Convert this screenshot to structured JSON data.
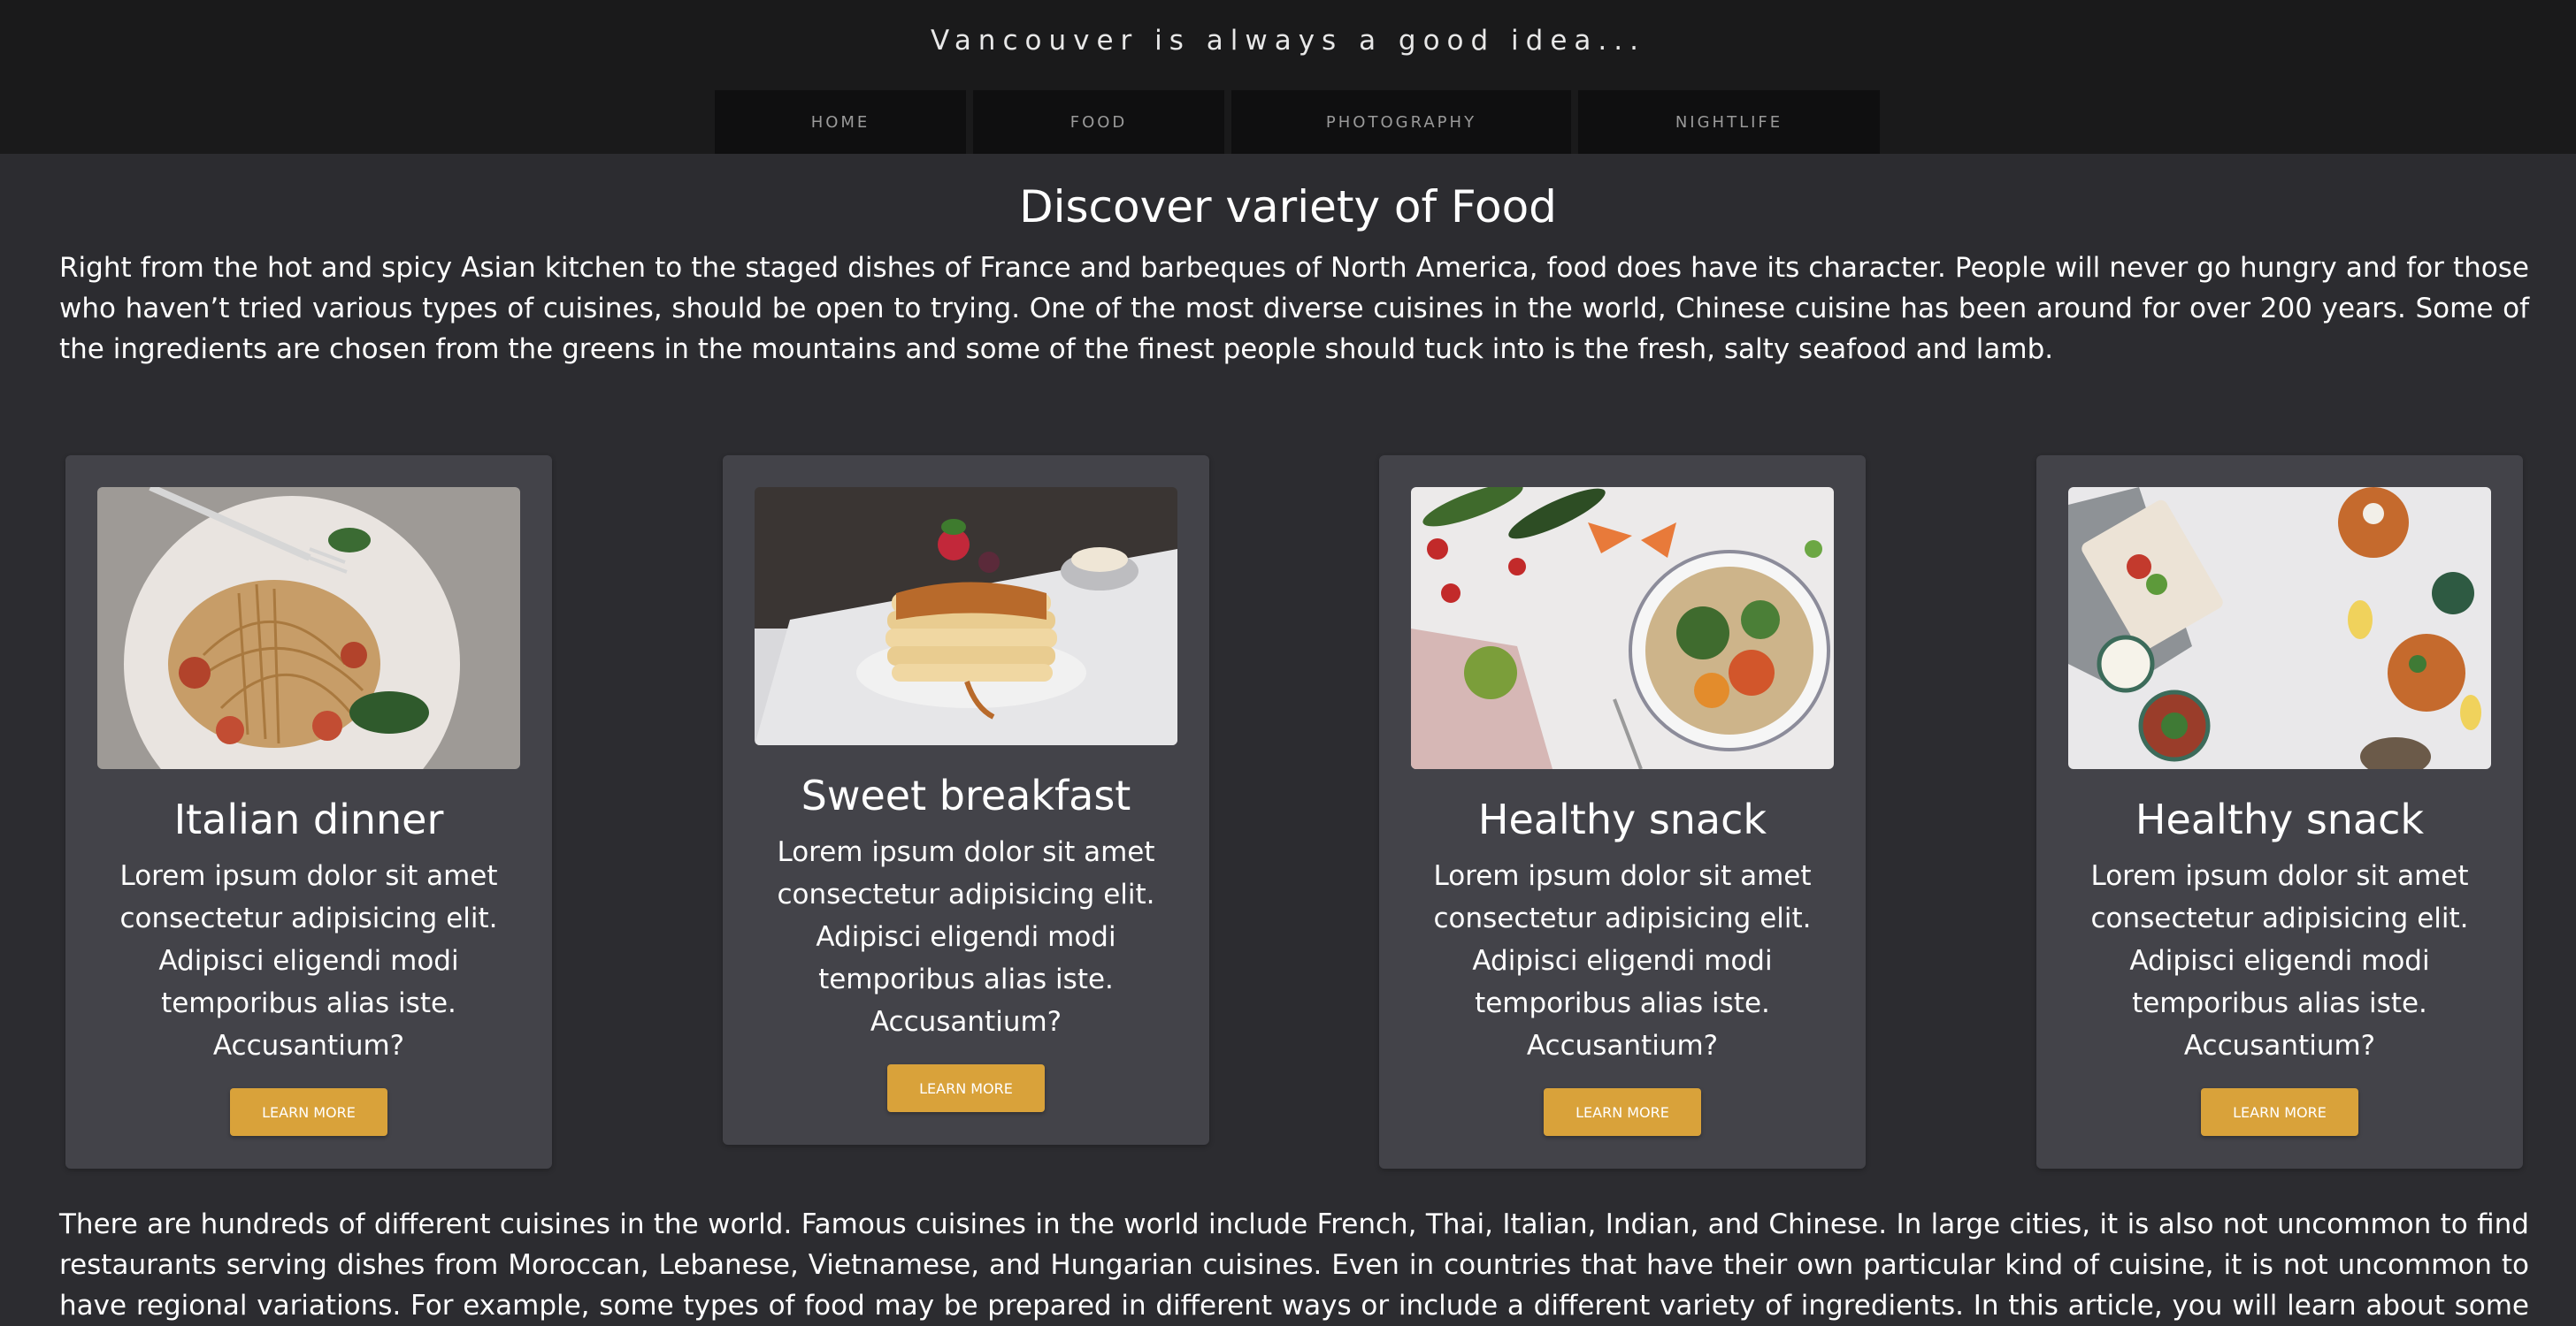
{
  "header": {
    "tagline": "Vancouver is always a good idea...",
    "nav": [
      {
        "label": "HOME"
      },
      {
        "label": "FOOD"
      },
      {
        "label": "PHOTOGRAPHY"
      },
      {
        "label": "NIGHTLIFE"
      }
    ]
  },
  "main": {
    "title": "Discover variety of Food",
    "intro": "Right from the hot and spicy Asian kitchen to the staged dishes of France and barbeques of North America, food does have its character. People will never go hungry and for those who haven’t tried various types of cuisines, should be open to trying. One of the most diverse cuisines in the world, Chinese cuisine has been around for over 200 years. Some of the ingredients are chosen from the greens in the mountains and some of the finest people should tuck into is the fresh, salty seafood and lamb.",
    "cards": [
      {
        "title": "Italian dinner",
        "text": "Lorem ipsum dolor sit amet consectetur adipisicing elit. Adipisci eligendi modi temporibus alias iste. Accusantium?",
        "button": "LEARN MORE",
        "image": "spaghetti-photo"
      },
      {
        "title": "Sweet breakfast",
        "text": "Lorem ipsum dolor sit amet consectetur adipisicing elit. Adipisci eligendi modi temporibus alias iste. Accusantium?",
        "button": "LEARN MORE",
        "image": "pancakes-photo"
      },
      {
        "title": "Healthy snack",
        "text": "Lorem ipsum dolor sit amet consectetur adipisicing elit. Adipisci eligendi modi temporibus alias iste. Accusantium?",
        "button": "LEARN MORE",
        "image": "vegetable-bowl-photo"
      },
      {
        "title": "Healthy snack",
        "text": "Lorem ipsum dolor sit amet consectetur adipisicing elit. Adipisci eligendi modi temporibus alias iste. Accusantium?",
        "button": "LEARN MORE",
        "image": "fries-table-photo"
      }
    ],
    "outro": "There are hundreds of different cuisines in the world. Famous cuisines in the world include French, Thai, Italian, Indian, and Chinese. In large cities, it is also not uncommon to find restaurants serving dishes from Moroccan, Lebanese, Vietnamese, and Hungarian cuisines. Even in countries that have their own particular kind of cuisine, it is not uncommon to have regional variations. For example, some types of food may be prepared in different ways or include a different variety of ingredients. In this article, you will learn about some of the top cuisines in the world. You will also"
  },
  "colors": {
    "header_bg": "#1a1a1b",
    "page_bg": "#2c2c30",
    "card_bg": "#434349",
    "nav_bg": "#0f0f10",
    "button_accent": "#d9a23a"
  }
}
